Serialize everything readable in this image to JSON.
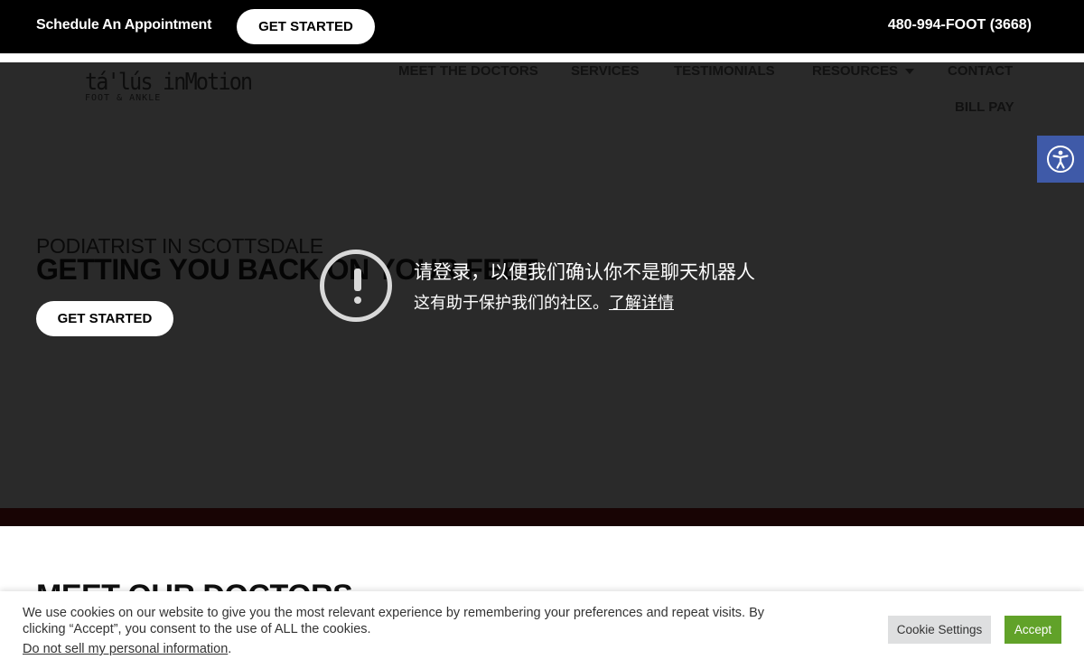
{
  "topbar": {
    "appointment_text": "Schedule An Appointment",
    "cta_label": "GET STARTED",
    "phone": "480-994-FOOT (3668)"
  },
  "logo": {
    "name": "tá'lús inMotion",
    "tagline": "FOOT & ANKLE"
  },
  "nav": {
    "items": [
      {
        "label": "MEET THE DOCTORS"
      },
      {
        "label": "SERVICES"
      },
      {
        "label": "TESTIMONIALS"
      },
      {
        "label": "RESOURCES"
      },
      {
        "label": "CONTACT"
      },
      {
        "label": "BILL PAY"
      }
    ]
  },
  "hero": {
    "kicker": "PODIATRIST IN SCOTTSDALE",
    "headline": "GETTING YOU BACK ON YOUR FEET",
    "cta_label": "GET STARTED"
  },
  "overlay": {
    "line1": "请登录，以便我们确认你不是聊天机器人",
    "line2": "这有助于保护我们的社区。",
    "link": "了解详情"
  },
  "doctors": {
    "title": "MEET OUR DOCTORS"
  },
  "cookie": {
    "message": "We use cookies on our website to give you the most relevant experience by remembering your preferences and repeat visits. By clicking “Accept”, you consent to the use of ALL the cookies.",
    "do_not_sell": "Do not sell my personal information",
    "settings_label": "Cookie Settings",
    "accept_label": "Accept"
  },
  "colors": {
    "topbar": "#000000",
    "hero": "#2a2a2a",
    "accessibility": "#3f5aa8",
    "accept": "#61a229"
  }
}
